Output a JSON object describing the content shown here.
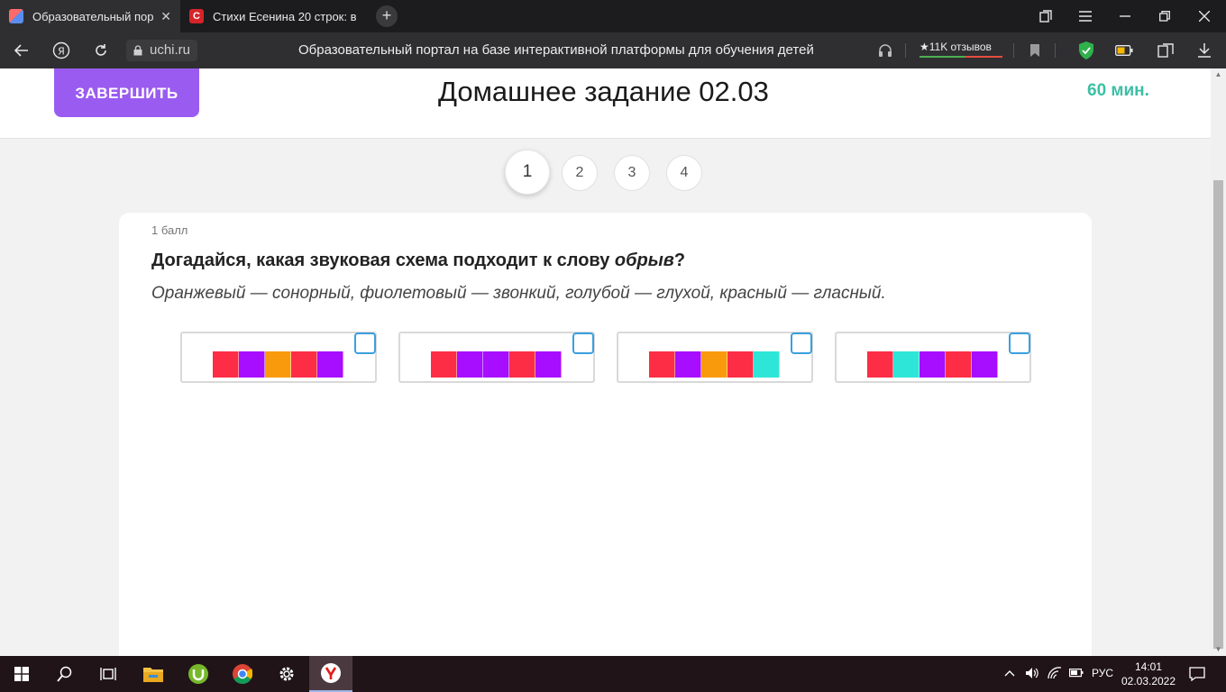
{
  "browser": {
    "tabs": [
      {
        "title": "Образовательный порт",
        "active": true
      },
      {
        "title": "Стихи Есенина 20 строк: в",
        "active": false
      }
    ],
    "url": "uchi.ru",
    "page_title": "Образовательный портал на базе интерактивной платформы для обучения детей",
    "reviews": "★11K отзывов"
  },
  "header": {
    "finish_label": "ЗАВЕРШИТЬ",
    "title": "Домашнее задание 02.03",
    "timer": "60 мин."
  },
  "pager": {
    "pages": [
      "1",
      "2",
      "3",
      "4"
    ],
    "active": "1"
  },
  "task": {
    "points": "1 балл",
    "question_prefix": "Догадайся, какая звуковая схема подходит к слову ",
    "question_word": "обрыв",
    "question_suffix": "?",
    "hint": "Оранжевый — сонорный, фиолетовый — звонкий, голубой — глухой, красный — гласный.",
    "colors": {
      "red": "#fc2d45",
      "purple": "#a70dff",
      "orange": "#f99a0c",
      "cyan": "#2ee6d8"
    },
    "options": [
      [
        "red",
        "purple",
        "orange",
        "red",
        "purple"
      ],
      [
        "red",
        "purple",
        "purple",
        "red",
        "purple"
      ],
      [
        "red",
        "purple",
        "orange",
        "red",
        "cyan"
      ],
      [
        "red",
        "cyan",
        "purple",
        "red",
        "purple"
      ]
    ]
  },
  "taskbar": {
    "lang": "РУС",
    "time": "14:01",
    "date": "02.03.2022"
  }
}
